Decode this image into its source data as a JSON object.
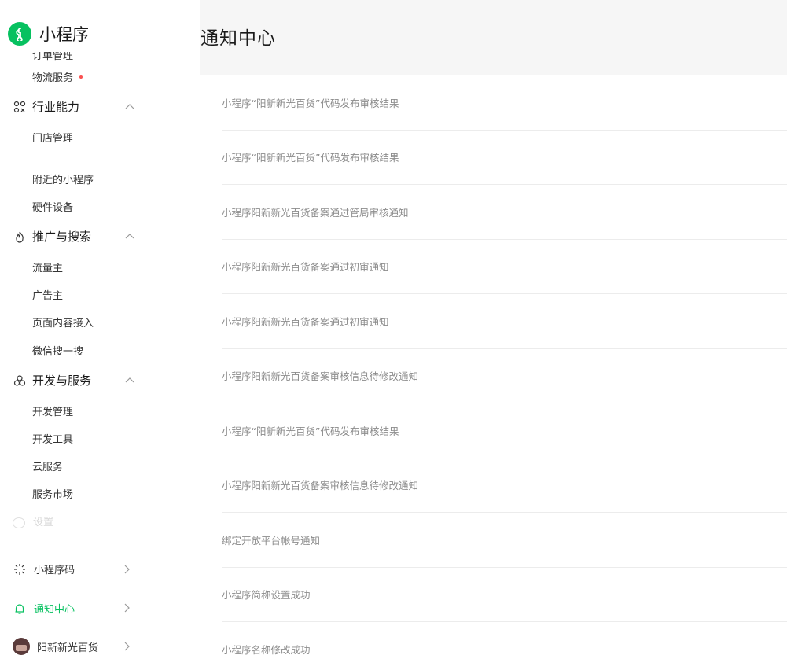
{
  "app": {
    "logo_text": "小程序"
  },
  "header": {
    "title": "通知中心"
  },
  "sidebar": {
    "cut_item": "订单管理",
    "logistics": "物流服务",
    "industry": {
      "label": "行业能力",
      "items": [
        "门店管理",
        "附近的小程序",
        "硬件设备"
      ]
    },
    "promo": {
      "label": "推广与搜索",
      "items": [
        "流量主",
        "广告主",
        "页面内容接入",
        "微信搜一搜"
      ]
    },
    "dev": {
      "label": "开发与服务",
      "items": [
        "开发管理",
        "开发工具",
        "云服务",
        "服务市场"
      ]
    },
    "faded": "设置",
    "bottom": [
      {
        "label": "小程序码",
        "icon": "qrcode-sun-icon"
      },
      {
        "label": "通知中心",
        "icon": "bell-icon"
      },
      {
        "label": "阳新新光百货",
        "icon": "avatar"
      }
    ]
  },
  "notifications": [
    "小程序“阳新新光百货”代码发布审核结果",
    "小程序“阳新新光百货”代码发布审核结果",
    "小程序阳新新光百货备案通过管局审核通知",
    "小程序阳新新光百货备案通过初审通知",
    "小程序阳新新光百货备案通过初审通知",
    "小程序阳新新光百货备案审核信息待修改通知",
    "小程序“阳新新光百货”代码发布审核结果",
    "小程序阳新新光百货备案审核信息待修改通知",
    "绑定开放平台帐号通知",
    "小程序简称设置成功",
    "小程序名称修改成功"
  ],
  "colors": {
    "accent": "#07c160",
    "dot": "#fa5151"
  }
}
